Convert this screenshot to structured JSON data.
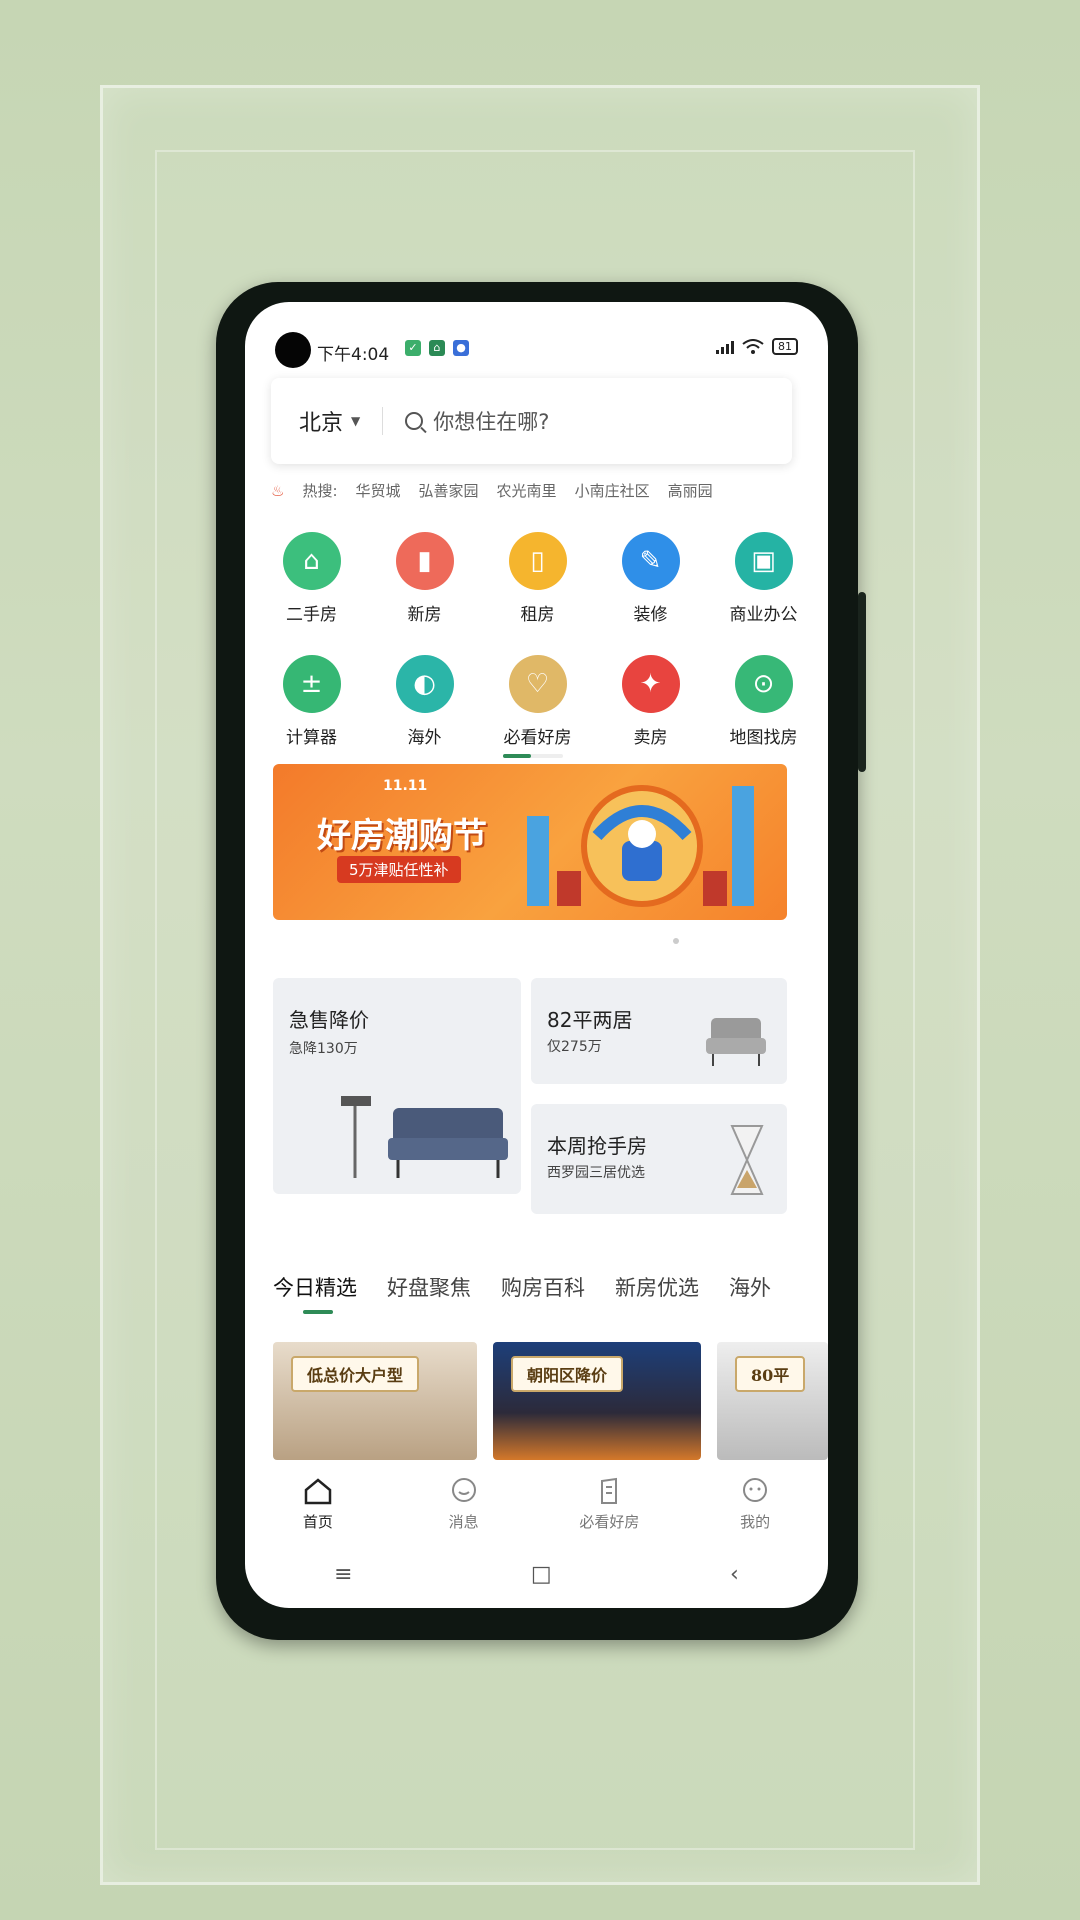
{
  "status": {
    "time": "下午4:04",
    "battery": "81"
  },
  "search": {
    "city": "北京",
    "placeholder": "你想住在哪?"
  },
  "hot": {
    "label": "热搜:",
    "items": [
      "华贸城",
      "弘善家园",
      "农光南里",
      "小南庄社区",
      "高丽园"
    ]
  },
  "grid": [
    {
      "label": "二手房",
      "icon": "house-icon",
      "color": "#3cbf7d"
    },
    {
      "label": "新房",
      "icon": "building-icon",
      "color": "#ee6a5a"
    },
    {
      "label": "租房",
      "icon": "door-icon",
      "color": "#f5b52e"
    },
    {
      "label": "装修",
      "icon": "brush-icon",
      "color": "#2f8fe8"
    },
    {
      "label": "商业办公",
      "icon": "shop-icon",
      "color": "#25b3a4"
    },
    {
      "label": "计算器",
      "icon": "calculator-icon",
      "color": "#36b774"
    },
    {
      "label": "海外",
      "icon": "globe-icon",
      "color": "#2bb5a8"
    },
    {
      "label": "必看好房",
      "icon": "heart-house-icon",
      "color": "#e0b867"
    },
    {
      "label": "卖房",
      "icon": "sale-tag-icon",
      "color": "#e8443f"
    },
    {
      "label": "地图找房",
      "icon": "map-pin-icon",
      "color": "#37b877"
    }
  ],
  "banner": {
    "title": "好房潮购节",
    "subtitle": "5万津贴任性补",
    "badge": "11.11"
  },
  "cards": {
    "sale": {
      "title": "急售降价",
      "sub": "急降130万"
    },
    "two_room": {
      "title": "82平两居",
      "sub": "仅275万"
    },
    "weekly": {
      "title": "本周抢手房",
      "sub": "西罗园三居优选"
    }
  },
  "tabs": [
    "今日精选",
    "好盘聚焦",
    "购房百科",
    "新房优选",
    "海外"
  ],
  "thumbs": [
    "低总价大户型",
    "朝阳区降价",
    "80平"
  ],
  "bottom_nav": [
    "首页",
    "消息",
    "必看好房",
    "我的"
  ],
  "sysnav": {
    "menu": "≡",
    "home": "□",
    "back": "‹"
  }
}
